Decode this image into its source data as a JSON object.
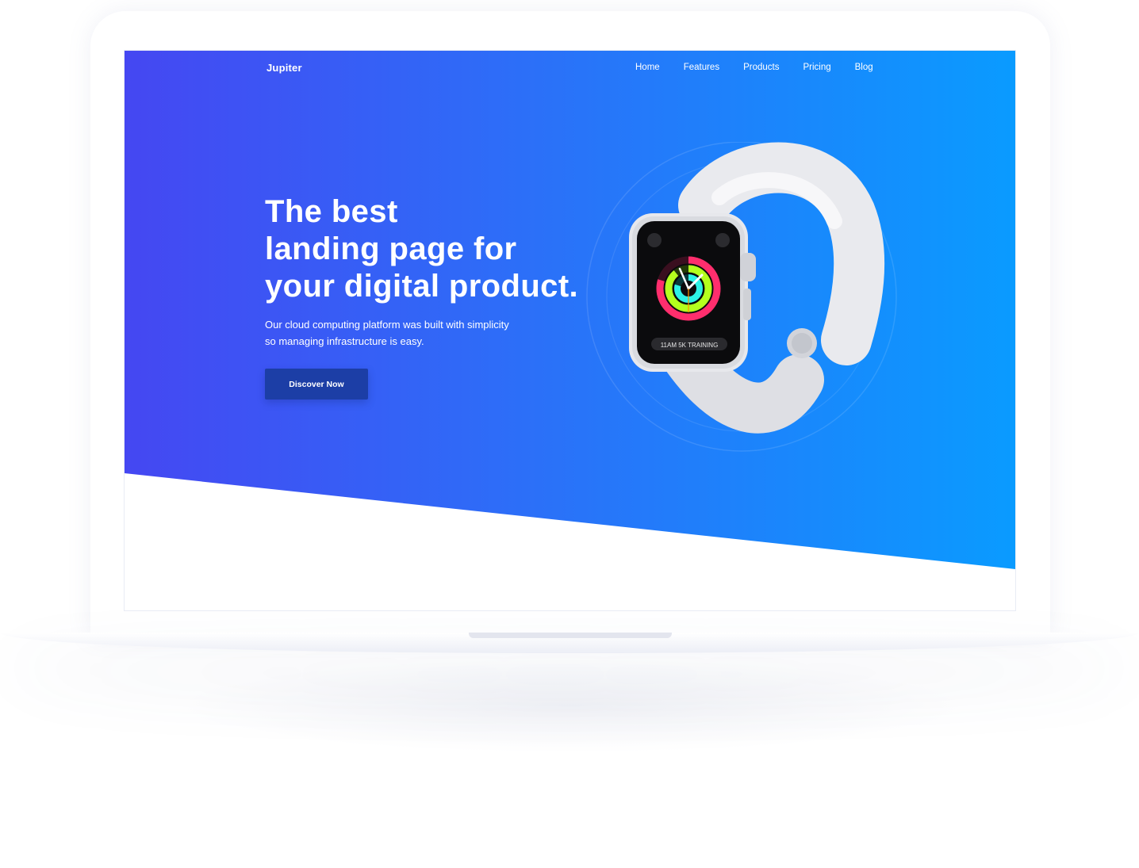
{
  "brand": {
    "name": "Jupiter"
  },
  "nav": {
    "items": [
      "Home",
      "Features",
      "Products",
      "Pricing",
      "Blog"
    ]
  },
  "hero": {
    "headline": [
      "The best",
      "landing page for",
      "your digital product."
    ],
    "subtext": [
      "Our cloud computing platform was built with simplicity",
      "so managing infrastructure is easy."
    ],
    "cta_label": "Discover Now",
    "watch_screen_label": "11AM 5K TRAINING"
  },
  "colors": {
    "gradient_start": "#4547f2",
    "gradient_end": "#0a9bff",
    "button": "#1c3ea6",
    "text": "#ffffff"
  },
  "icons": [
    "watch-product-icon",
    "weather-complication-icon",
    "runner-complication-icon"
  ]
}
